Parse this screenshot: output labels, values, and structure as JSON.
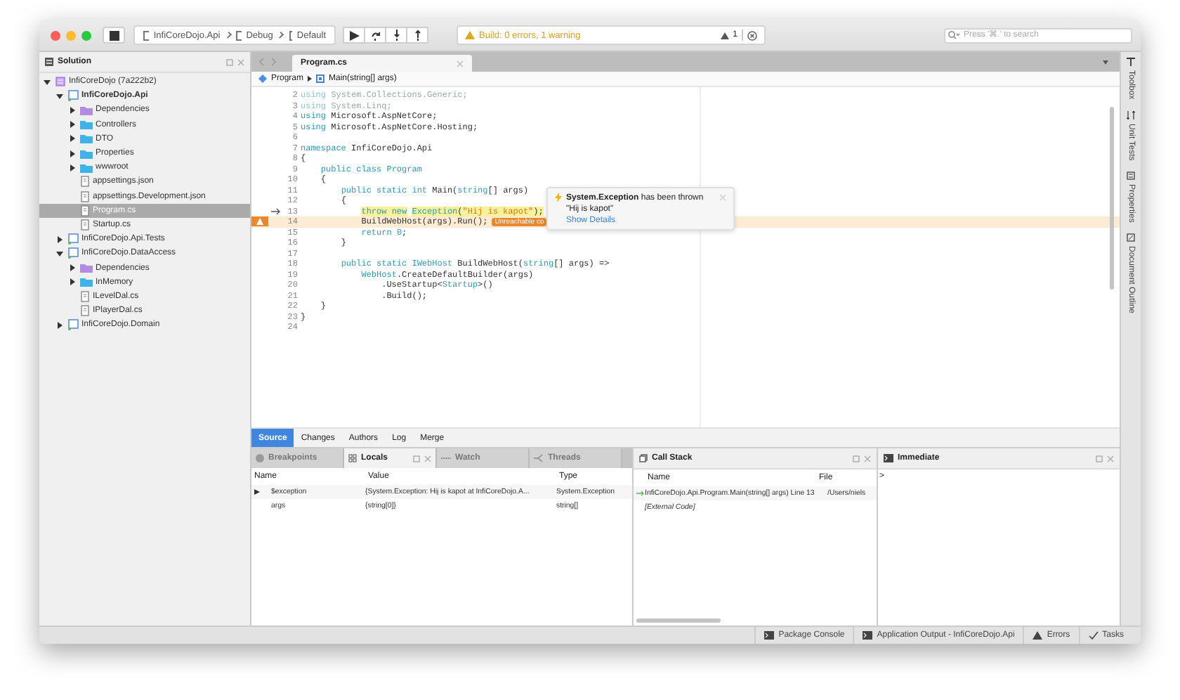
{
  "toolbar": {
    "config": [
      "InfiCoreDojo.Api",
      "Debug",
      "Default"
    ],
    "build_status": "Build: 0 errors, 1 warning",
    "warning_count": "1",
    "search": {
      "placeholder": "Press '⌘.' to search"
    }
  },
  "sidebar": {
    "title": "Solution",
    "tree": [
      {
        "label": "InfiCoreDojo (7a222b2)",
        "kind": "solution",
        "selected": false,
        "expanded": true,
        "children": [
          {
            "label": "InfiCoreDojo.Api",
            "kind": "project",
            "bold": true,
            "selected": false,
            "expanded": true,
            "children": [
              {
                "label": "Dependencies",
                "kind": "refs",
                "selected": false,
                "expanded": false
              },
              {
                "label": "Controllers",
                "kind": "folder",
                "selected": false,
                "expanded": false
              },
              {
                "label": "DTO",
                "kind": "folder",
                "selected": false,
                "expanded": false
              },
              {
                "label": "Properties",
                "kind": "folder",
                "selected": false,
                "expanded": false
              },
              {
                "label": "wwwroot",
                "kind": "folder",
                "selected": false,
                "expanded": false
              },
              {
                "label": "appsettings.json",
                "kind": "file",
                "selected": false
              },
              {
                "label": "appsettings.Development.json",
                "kind": "file",
                "selected": false
              },
              {
                "label": "Program.cs",
                "kind": "file",
                "selected": true
              },
              {
                "label": "Startup.cs",
                "kind": "file",
                "selected": false
              }
            ]
          },
          {
            "label": "InfiCoreDojo.Api.Tests",
            "kind": "project",
            "selected": false,
            "expanded": false
          },
          {
            "label": "InfiCoreDojo.DataAccess",
            "kind": "project",
            "selected": false,
            "expanded": true,
            "children": [
              {
                "label": "Dependencies",
                "kind": "refs",
                "selected": false,
                "expanded": false
              },
              {
                "label": "InMemory",
                "kind": "folder",
                "selected": false,
                "expanded": false
              },
              {
                "label": "ILevelDal.cs",
                "kind": "file",
                "selected": false
              },
              {
                "label": "IPlayerDal.cs",
                "kind": "file",
                "selected": false
              }
            ]
          },
          {
            "label": "InfiCoreDojo.Domain",
            "kind": "project",
            "selected": false,
            "expanded": false
          }
        ]
      }
    ]
  },
  "editor": {
    "tab": "Program.cs",
    "breadcrumb": [
      "Program",
      "Main(string[] args)"
    ],
    "lines": [
      {
        "n": "2",
        "parts": [
          {
            "kind": "dimkw",
            "text": "using"
          },
          {
            "kind": "dim",
            "text": " System.Collections.Generic;"
          }
        ]
      },
      {
        "n": "3",
        "parts": [
          {
            "kind": "dimkw",
            "text": "using"
          },
          {
            "kind": "dim",
            "text": " System.Linq;"
          }
        ]
      },
      {
        "n": "4",
        "parts": [
          {
            "kind": "kw",
            "text": "using"
          },
          {
            "kind": "plain",
            "text": " Microsoft.AspNetCore;"
          }
        ]
      },
      {
        "n": "5",
        "parts": [
          {
            "kind": "kw",
            "text": "using"
          },
          {
            "kind": "plain",
            "text": " Microsoft.AspNetCore.Hosting;"
          }
        ]
      },
      {
        "n": "6"
      },
      {
        "n": "7",
        "parts": [
          {
            "kind": "kw",
            "text": "namespace"
          },
          {
            "kind": "plain",
            "text": " InfiCoreDojo.Api"
          }
        ]
      },
      {
        "n": "8",
        "parts": [
          {
            "kind": "plain",
            "text": "{"
          }
        ]
      },
      {
        "n": "9",
        "parts": [
          {
            "kind": "kw",
            "text": "    public class"
          },
          {
            "kind": "type",
            "text": " Program"
          }
        ]
      },
      {
        "n": "10",
        "parts": [
          {
            "kind": "plain",
            "text": "    {"
          }
        ]
      },
      {
        "n": "11",
        "parts": [
          {
            "kind": "kw",
            "text": "        public static int"
          },
          {
            "kind": "plain",
            "text": " Main("
          },
          {
            "kind": "kw",
            "text": "string"
          },
          {
            "kind": "plain",
            "text": "[] args)"
          }
        ]
      },
      {
        "n": "12",
        "parts": [
          {
            "kind": "plain",
            "text": "        {"
          }
        ]
      },
      {
        "n": "13",
        "current": true,
        "highlight": true,
        "parts": [
          {
            "kind": "kw",
            "text": "            throw new"
          },
          {
            "kind": "type",
            "text": " Exception"
          },
          {
            "kind": "plain",
            "text": "("
          },
          {
            "kind": "str",
            "text": "\"Hij is kapot\""
          },
          {
            "kind": "plain",
            "text": ");"
          }
        ]
      },
      {
        "n": "14",
        "warning": true,
        "badge": "Unreachable co",
        "parts": [
          {
            "kind": "plain",
            "text": "            BuildWebHost(args).Run();"
          }
        ]
      },
      {
        "n": "15",
        "parts": [
          {
            "kind": "kw",
            "text": "            return"
          },
          {
            "kind": "num",
            "text": " 0"
          },
          {
            "kind": "plain",
            "text": ";"
          }
        ]
      },
      {
        "n": "16",
        "parts": [
          {
            "kind": "plain",
            "text": "        }"
          }
        ]
      },
      {
        "n": "17"
      },
      {
        "n": "18",
        "parts": [
          {
            "kind": "kw",
            "text": "        public static"
          },
          {
            "kind": "type",
            "text": " IWebHost"
          },
          {
            "kind": "plain",
            "text": " BuildWebHost("
          },
          {
            "kind": "kw",
            "text": "string"
          },
          {
            "kind": "plain",
            "text": "[] args) =>"
          }
        ]
      },
      {
        "n": "19",
        "parts": [
          {
            "kind": "type",
            "text": "            WebHost"
          },
          {
            "kind": "plain",
            "text": ".CreateDefaultBuilder(args)"
          }
        ]
      },
      {
        "n": "20",
        "parts": [
          {
            "kind": "plain",
            "text": "                .UseStartup<"
          },
          {
            "kind": "type",
            "text": "Startup"
          },
          {
            "kind": "plain",
            "text": ">()"
          }
        ]
      },
      {
        "n": "21",
        "parts": [
          {
            "kind": "plain",
            "text": "                .Build();"
          }
        ]
      },
      {
        "n": "22",
        "parts": [
          {
            "kind": "plain",
            "text": "    }"
          }
        ]
      },
      {
        "n": "23",
        "parts": [
          {
            "kind": "plain",
            "text": "}"
          }
        ]
      },
      {
        "n": "24"
      }
    ],
    "exception_popup": {
      "title": "**System.Exception** has been thrown",
      "message": "\"Hij is kapot\"",
      "link": "Show Details"
    }
  },
  "vc_tabs": [
    {
      "label": "Source",
      "selected": true
    },
    {
      "label": "Changes",
      "selected": false
    },
    {
      "label": "Authors",
      "selected": false
    },
    {
      "label": "Log",
      "selected": false
    },
    {
      "label": "Merge",
      "selected": false
    }
  ],
  "locals_pad": {
    "tabs": [
      {
        "label": "Breakpoints",
        "selected": false
      },
      {
        "label": "Locals",
        "selected": true
      },
      {
        "label": "Watch",
        "selected": false
      },
      {
        "label": "Threads",
        "selected": false
      }
    ],
    "columns": [
      "Name",
      "Value",
      "Type"
    ],
    "rows": [
      {
        "expanded": false,
        "cells": [
          "$exception",
          "{System.Exception: Hij is kapot    at InfiCoreDojo.A...",
          "System.Exception"
        ]
      },
      {
        "cells": [
          "args",
          "{string[0]}",
          "string[]"
        ]
      }
    ]
  },
  "call_stack": {
    "title": "Call Stack",
    "columns": [
      "Name",
      "File"
    ],
    "rows": [
      {
        "current": true,
        "cells": [
          "InfiCoreDojo.Api.Program.Main(string[] args) Line 13",
          "/Users/niels"
        ]
      },
      {
        "current": false,
        "italic": true,
        "cells": [
          "[External Code]"
        ]
      }
    ]
  },
  "immediate": {
    "title": "Immediate",
    "prompt": ">"
  },
  "right_strip": [
    "Toolbox",
    "Unit Tests",
    "Properties",
    "Document Outline"
  ],
  "status_bar": [
    "Package Console",
    "Application Output - InfiCoreDojo.Api",
    "Errors",
    "Tasks"
  ]
}
